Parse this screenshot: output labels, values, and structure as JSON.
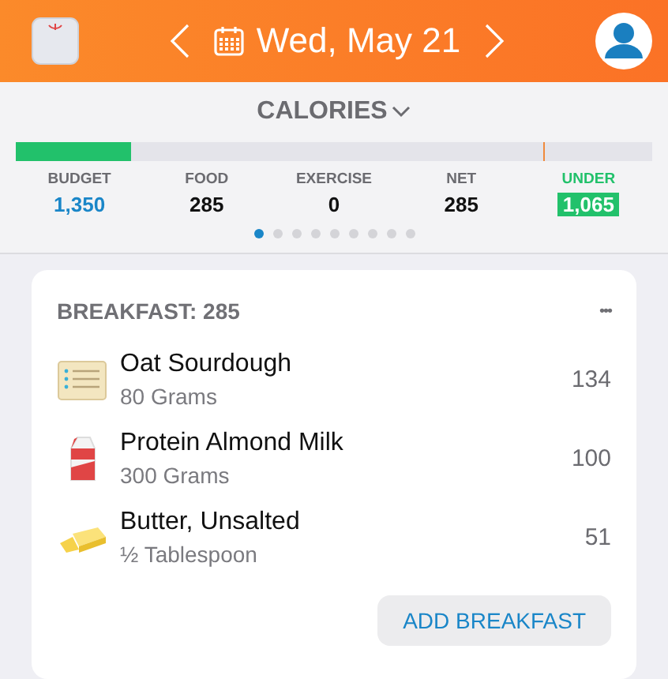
{
  "header": {
    "date": "Wed, May 21"
  },
  "summary": {
    "title": "CALORIES",
    "bar": {
      "level": 0.18,
      "goal": {
        "level": 0.83
      }
    },
    "stats": [
      {
        "label": "BUDGET",
        "value": "1,350",
        "kind": "budget"
      },
      {
        "label": "FOOD",
        "value": "285",
        "kind": "plain"
      },
      {
        "label": "EXERCISE",
        "value": "0",
        "kind": "plain"
      },
      {
        "label": "NET",
        "value": "285",
        "kind": "plain"
      },
      {
        "label": "UNDER",
        "value": "1,065",
        "kind": "under"
      }
    ],
    "pages": [
      {
        "selected": true
      },
      {
        "selected": false
      },
      {
        "selected": false
      },
      {
        "selected": false
      },
      {
        "selected": false
      },
      {
        "selected": false
      },
      {
        "selected": false
      },
      {
        "selected": false
      },
      {
        "selected": false
      }
    ]
  },
  "meal": {
    "title": "BREAKFAST: 285",
    "more": "•••",
    "items": [
      {
        "name": "Oat Sourdough",
        "amount": "80 Grams",
        "calories": "134",
        "kind": "bread"
      },
      {
        "name": "Protein Almond Milk",
        "amount": "300 Grams",
        "calories": "100",
        "kind": "milk"
      },
      {
        "name": "Butter, Unsalted",
        "amount": "½ Tablespoon",
        "calories": "51",
        "kind": "butter"
      }
    ],
    "add_button": "ADD BREAKFAST"
  }
}
